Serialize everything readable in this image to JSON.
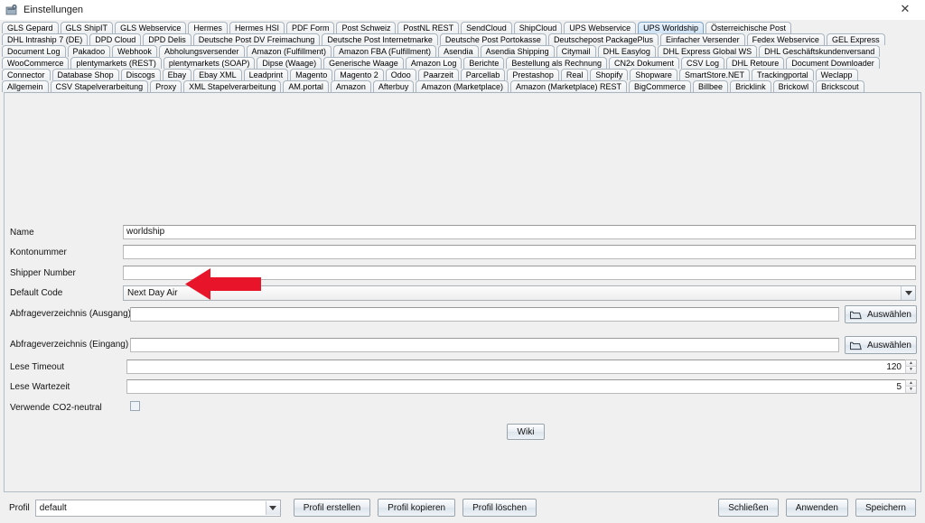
{
  "window": {
    "title": "Einstellungen",
    "icon": "app-settings-icon",
    "close_label": "✕"
  },
  "tabs": {
    "selected": "UPS Worldship",
    "rows": [
      [
        "GLS Gepard",
        "GLS ShipIT",
        "GLS Webservice",
        "Hermes",
        "Hermes HSI",
        "PDF Form",
        "Post Schweiz",
        "PostNL REST",
        "SendCloud",
        "ShipCloud",
        "UPS Webservice",
        "UPS Worldship",
        "Österreichische Post"
      ],
      [
        "DHL Intraship 7 (DE)",
        "DPD Cloud",
        "DPD Delis",
        "Deutsche Post DV Freimachung",
        "Deutsche Post Internetmarke",
        "Deutsche Post Portokasse",
        "Deutschepost PackagePlus",
        "Einfacher Versender",
        "Fedex Webservice",
        "GEL Express"
      ],
      [
        "Document Log",
        "Pakadoo",
        "Webhook",
        "Abholungsversender",
        "Amazon (Fulfillment)",
        "Amazon FBA (Fulfillment)",
        "Asendia",
        "Asendia Shipping",
        "Citymail",
        "DHL Easylog",
        "DHL Express Global WS",
        "DHL Geschäftskundenversand"
      ],
      [
        "WooCommerce",
        "plentymarkets (REST)",
        "plentymarkets (SOAP)",
        "Dipse (Waage)",
        "Generische Waage",
        "Amazon Log",
        "Berichte",
        "Bestellung als Rechnung",
        "CN2x Dokument",
        "CSV Log",
        "DHL Retoure",
        "Document Downloader"
      ],
      [
        "Connector",
        "Database Shop",
        "Discogs",
        "Ebay",
        "Ebay XML",
        "Leadprint",
        "Magento",
        "Magento 2",
        "Odoo",
        "Paarzeit",
        "Parcellab",
        "Prestashop",
        "Real",
        "Shopify",
        "Shopware",
        "SmartStore.NET",
        "Trackingportal",
        "Weclapp"
      ],
      [
        "Allgemein",
        "CSV Stapelverarbeitung",
        "Proxy",
        "XML Stapelverarbeitung",
        "AM.portal",
        "Amazon",
        "Afterbuy",
        "Amazon (Marketplace)",
        "Amazon (Marketplace) REST",
        "BigCommerce",
        "Billbee",
        "Bricklink",
        "Brickowl",
        "Brickscout"
      ]
    ]
  },
  "form": {
    "fields": [
      {
        "label": "Name",
        "type": "text",
        "value": "worldship"
      },
      {
        "label": "Kontonummer",
        "type": "text",
        "value": ""
      },
      {
        "label": "Shipper Number",
        "type": "text",
        "value": ""
      },
      {
        "label": "Default Code",
        "type": "combo",
        "value": "Next Day Air"
      },
      {
        "label": "Abfrageverzeichnis (Ausgang)",
        "type": "text-browse",
        "value": "",
        "button": "Auswählen"
      },
      {
        "label": "Abfrageverzeichnis (Eingang)",
        "type": "text-browse",
        "value": "",
        "button": "Auswählen"
      },
      {
        "label": "Lese Timeout",
        "type": "spinner",
        "value": "120"
      },
      {
        "label": "Lese Wartezeit",
        "type": "spinner",
        "value": "5"
      },
      {
        "label": "Verwende CO2-neutral",
        "type": "checkbox",
        "value": ""
      }
    ],
    "wiki_button": "Wiki"
  },
  "bottom": {
    "profile_label": "Profil",
    "profile_value": "default",
    "create_label": "Profil erstellen",
    "copy_label": "Profil kopieren",
    "delete_label": "Profil löschen",
    "close_label": "Schließen",
    "apply_label": "Anwenden",
    "save_label": "Speichern"
  },
  "annotation": {
    "arrow_color": "#e8142a",
    "arrow_direction": "left",
    "points_at": "Name"
  }
}
